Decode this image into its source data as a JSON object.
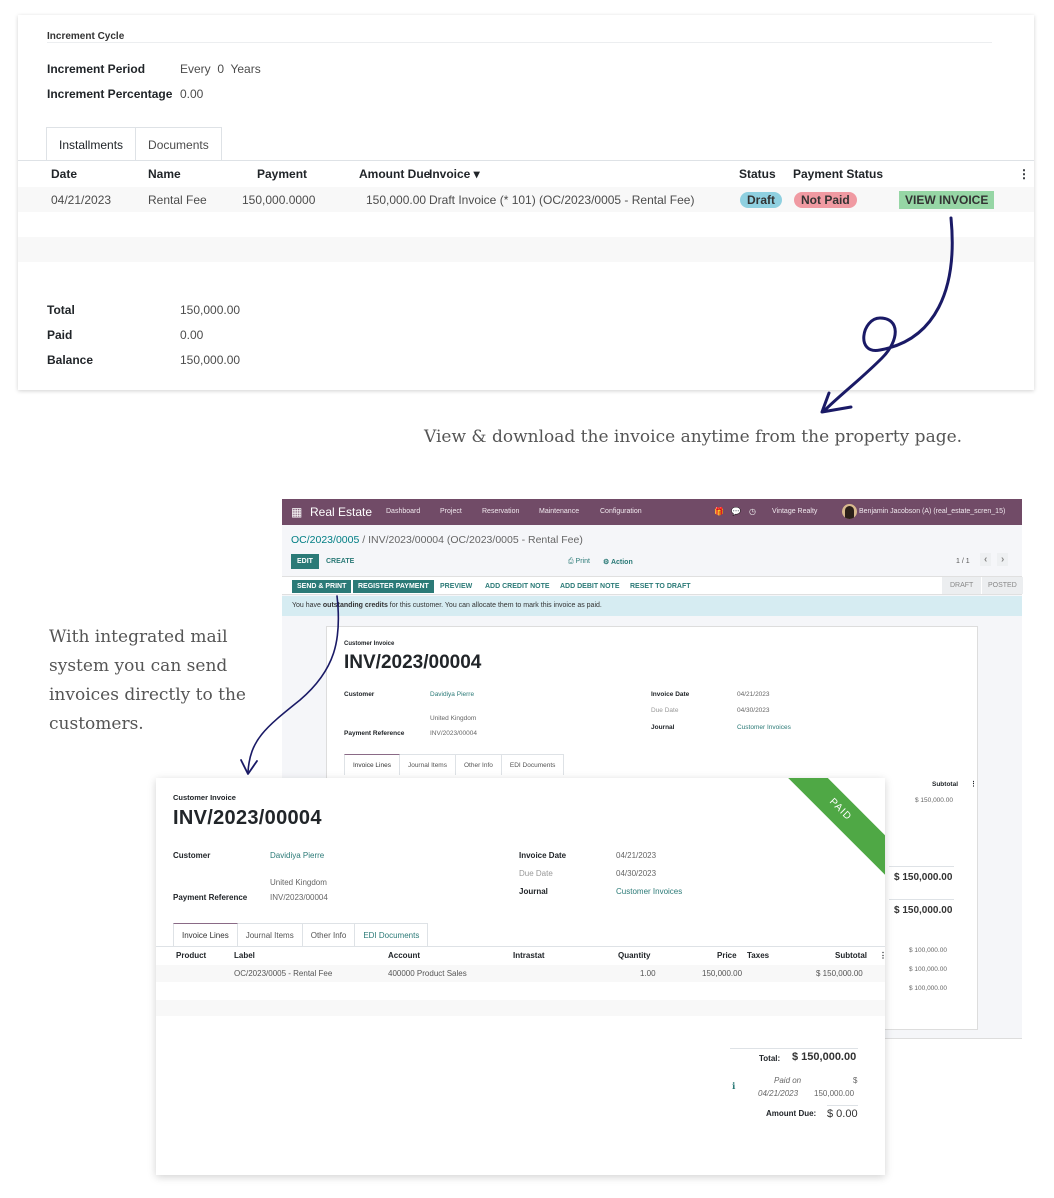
{
  "property": {
    "cycle_title": "Increment Cycle",
    "fields": [
      {
        "label": "Increment Period",
        "value": "Every  0  Years"
      },
      {
        "label": "Increment Percentage",
        "value": "0.00"
      }
    ],
    "tabs": [
      "Installments",
      "Documents"
    ],
    "columns": [
      "Date",
      "Name",
      "Payment",
      "Amount Due",
      "Invoice ▾",
      "Status",
      "Payment Status"
    ],
    "rows": [
      {
        "date": "04/21/2023",
        "name": "Rental Fee",
        "payment": "150,000.0000",
        "amount_due": "150,000.00",
        "invoice": "Draft Invoice (* 101) (OC/2023/0005 - Rental Fee)",
        "status": "Draft",
        "payment_status": "Not Paid",
        "action": "VIEW INVOICE"
      }
    ],
    "summary": [
      {
        "label": "Total",
        "value": "150,000.00"
      },
      {
        "label": "Paid",
        "value": "0.00"
      },
      {
        "label": "Balance",
        "value": "150,000.00"
      }
    ]
  },
  "captions": {
    "view_download": "View & download the invoice anytime from the property page.",
    "mail_system": "With integrated mail system you can send invoices directly to the customers."
  },
  "odoo": {
    "app_name": "Real Estate",
    "menu": [
      "Dashboard",
      "Project",
      "Reservation",
      "Maintenance",
      "Configuration"
    ],
    "company": "Vintage Realty",
    "user": "Benjamin Jacobson (A) (real_estate_scren_15)",
    "breadcrumb_parent": "OC/2023/0005",
    "breadcrumb_current": " / INV/2023/00004 (OC/2023/0005 - Rental Fee)",
    "edit": "EDIT",
    "create": "CREATE",
    "print": "⎙ Print",
    "action": "⚙ Action",
    "pager": "1 / 1",
    "buttons": [
      "SEND & PRINT",
      "REGISTER PAYMENT",
      "PREVIEW",
      "ADD CREDIT NOTE",
      "ADD DEBIT NOTE",
      "RESET TO DRAFT"
    ],
    "stages": [
      "DRAFT",
      "POSTED"
    ],
    "alert_prefix": "You have ",
    "alert_bold": "outstanding credits",
    "alert_suffix": " for this customer. You can allocate them to mark this invoice as paid.",
    "back_subtotals": [
      "$ 150,000.00",
      "$ 150,000.00",
      "$ 150,000.00",
      "$ 100,000.00",
      "$ 100,000.00",
      "$ 100,000.00"
    ],
    "subtotal_header": "Subtotal"
  },
  "invoice": {
    "type_label": "Customer Invoice",
    "number": "INV/2023/00004",
    "customer_label": "Customer",
    "customer": "Davidiya Pierre",
    "country": "United Kingdom",
    "payment_ref_label": "Payment Reference",
    "payment_ref": "INV/2023/00004",
    "invoice_date_label": "Invoice Date",
    "invoice_date": "04/21/2023",
    "due_date_label": "Due Date",
    "due_date": "04/30/2023",
    "journal_label": "Journal",
    "journal": "Customer Invoices",
    "ribbon": "PAID",
    "tabs": [
      "Invoice Lines",
      "Journal Items",
      "Other Info",
      "EDI Documents"
    ],
    "columns": [
      "Product",
      "Label",
      "Account",
      "Intrastat",
      "Quantity",
      "Price",
      "Taxes",
      "Subtotal"
    ],
    "lines": [
      {
        "product": "",
        "label": "OC/2023/0005 - Rental Fee",
        "account": "400000 Product Sales",
        "intrastat": "",
        "quantity": "1.00",
        "price": "150,000.00",
        "taxes": "",
        "subtotal": "$ 150,000.00"
      }
    ],
    "total_label": "Total:",
    "total": "$ 150,000.00",
    "paid_on_label": "Paid on",
    "paid_on_date": "04/21/2023",
    "paid_currency": "$",
    "paid_amount": "150,000.00",
    "amount_due_label": "Amount Due:",
    "amount_due": "$ 0.00"
  },
  "colors": {
    "navbar": "#714b67",
    "primary": "#2b7a77",
    "paid_ribbon": "#4fa845",
    "draft_badge": "#8fd0e0",
    "not_paid_badge": "#f09aa2",
    "view_invoice": "#96d6a5",
    "arrow": "#1a1a66"
  }
}
